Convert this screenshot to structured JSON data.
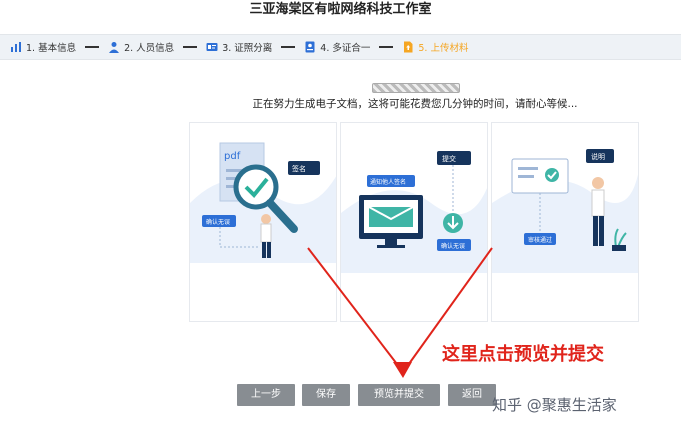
{
  "header": {
    "title": "三亚海棠区有啦网络科技工作室"
  },
  "steps": [
    {
      "label": "1. 基本信息",
      "icon": "chart-icon"
    },
    {
      "label": "2. 人员信息",
      "icon": "person-icon"
    },
    {
      "label": "3. 证照分离",
      "icon": "license-icon"
    },
    {
      "label": "4. 多证合一",
      "icon": "id-card-icon"
    },
    {
      "label": "5. 上传材料",
      "icon": "upload-doc-icon",
      "active": true
    }
  ],
  "main": {
    "wait_message": "正在努力生成电子文档，这将可能花费您几分钟的时间，请耐心等候..."
  },
  "illustrations": {
    "panel1": {
      "doc": "pdf",
      "tag1": "签名",
      "tag2": "确认无误"
    },
    "panel2": {
      "tag1": "通知他人签名",
      "tag2": "提交",
      "tag3": "确认无误"
    },
    "panel3": {
      "tag1": "说明",
      "tag2": "审核通过"
    }
  },
  "annotation": {
    "text": "这里点击预览并提交"
  },
  "buttons": {
    "prev": "上一步",
    "save": "保存",
    "preview_submit": "预览并提交",
    "back": "返回"
  },
  "watermark": {
    "text": "知乎 @聚惠生活家"
  },
  "colors": {
    "accent_blue": "#2d6fd6",
    "dark_navy": "#16345c",
    "annotation_red": "#e0241b",
    "step_active": "#f5a623",
    "button_gray": "#888d92"
  }
}
